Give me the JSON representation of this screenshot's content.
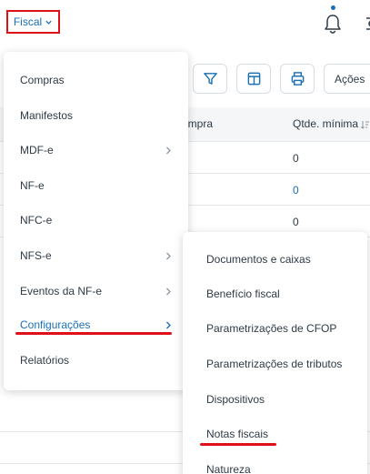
{
  "header": {
    "module_label": "Fiscal"
  },
  "toolbar": {
    "actions_label": "Ações"
  },
  "table": {
    "columns": [
      "ompra",
      "Qtde. mínima"
    ],
    "rows": [
      {
        "qty": "0",
        "highlight": false
      },
      {
        "qty": "0",
        "highlight": true
      },
      {
        "qty": "0",
        "highlight": false
      }
    ]
  },
  "menu": {
    "items": [
      {
        "label": "Compras",
        "has_submenu": false
      },
      {
        "label": "Manifestos",
        "has_submenu": false
      },
      {
        "label": "MDF-e",
        "has_submenu": true
      },
      {
        "label": "NF-e",
        "has_submenu": false
      },
      {
        "label": "NFC-e",
        "has_submenu": false
      },
      {
        "label": "NFS-e",
        "has_submenu": true
      },
      {
        "label": "Eventos da NF-e",
        "has_submenu": true
      },
      {
        "label": "Configurações",
        "has_submenu": true,
        "active": true
      },
      {
        "label": "Relatórios",
        "has_submenu": false
      }
    ]
  },
  "submenu": {
    "items": [
      {
        "label": "Documentos e caixas"
      },
      {
        "label": "Benefício fiscal"
      },
      {
        "label": "Parametrizações de CFOP"
      },
      {
        "label": "Parametrizações de tributos"
      },
      {
        "label": "Dispositivos"
      },
      {
        "label": "Notas fiscais"
      },
      {
        "label": "Natureza"
      }
    ]
  },
  "colors": {
    "accent": "#1a6fb5",
    "highlight_red": "#e0101a",
    "text": "#2f3a45"
  }
}
